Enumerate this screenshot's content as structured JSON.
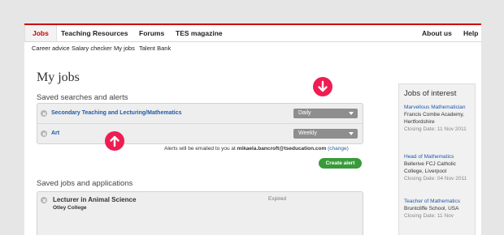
{
  "nav": {
    "items": [
      "Jobs",
      "Teaching Resources",
      "Forums",
      "TES magazine"
    ],
    "right_items": [
      "About us",
      "Help"
    ]
  },
  "subnav": {
    "items": [
      "Career advice",
      "Salary checker",
      "My jobs",
      "Talent Bank"
    ]
  },
  "page": {
    "title": "My jobs"
  },
  "alerts": {
    "section_title": "Saved searches and alerts",
    "rows": [
      {
        "label": "Secondary Teaching and Lecturing/Mathematics",
        "frequency": "Daily"
      },
      {
        "label": "Art",
        "frequency": "Weekly"
      }
    ],
    "notice_prefix": "Alerts will be emailed to you at",
    "email": "mikaela.bancroft@tseducation.com",
    "change_link": "(change)",
    "create_button": "Create alert"
  },
  "saved_jobs": {
    "section_title": "Saved jobs and applications",
    "items": [
      {
        "title": "Lecturer in Animal Science",
        "org": "Otley College",
        "status": "Expired"
      }
    ]
  },
  "jobs_of_interest": {
    "title": "Jobs of interest",
    "items": [
      {
        "title": "Marvellous Mathematician",
        "detail": "Francis Combe Academy, Hertfordshire",
        "closing": "Closing Date: 11 Nov 2011"
      },
      {
        "title": "Head of Mathematics",
        "detail": "Bellerive FCJ Catholic College, Liverpool",
        "closing": "Closing Date: 04 Nov 2011"
      },
      {
        "title": "Teacher of Mathematics",
        "detail": "Bruntcliffe School, USA",
        "closing": "Closing Date: 11 Nov"
      }
    ]
  },
  "colors": {
    "accent": "#cc0000",
    "link": "#1f5aa8",
    "annotation": "#ee1d52",
    "button": "#3a9a3a"
  },
  "annotations": [
    {
      "icon": "arrow-down-icon"
    },
    {
      "icon": "arrow-up-icon"
    }
  ]
}
